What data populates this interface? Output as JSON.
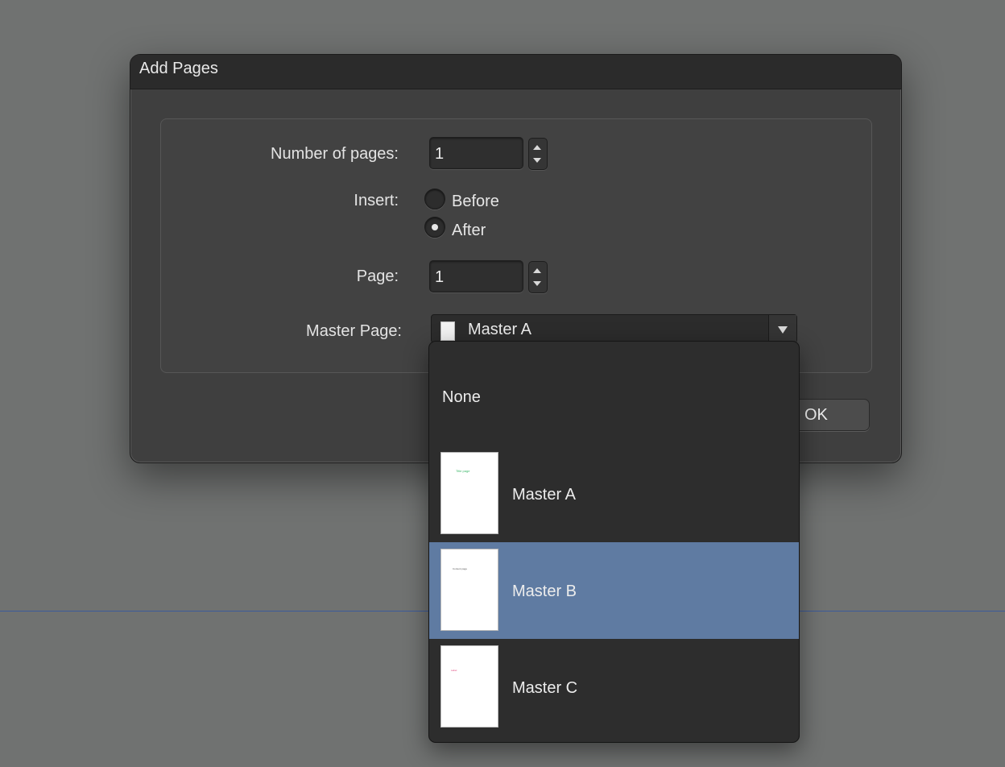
{
  "dialog": {
    "title": "Add Pages",
    "number_of_pages": {
      "label": "Number of pages:",
      "value": "1"
    },
    "insert": {
      "label": "Insert:",
      "options": [
        {
          "label": "Before",
          "checked": false
        },
        {
          "label": "After",
          "checked": true
        }
      ]
    },
    "page": {
      "label": "Page:",
      "value": "1"
    },
    "master_page": {
      "label": "Master Page:",
      "selected": "Master A"
    },
    "ok_label": "OK"
  },
  "dropdown": {
    "items": [
      {
        "label": "None",
        "thumbnail": null,
        "highlighted": false
      },
      {
        "label": "Master A",
        "thumbnail": {
          "text": "Title page",
          "color": "#3db86a"
        },
        "highlighted": false
      },
      {
        "label": "Master B",
        "thumbnail": {
          "text": "Content page",
          "color": "#555555"
        },
        "highlighted": true
      },
      {
        "label": "Master C",
        "thumbnail": {
          "text": "Label",
          "color": "#e0457b"
        },
        "highlighted": false
      }
    ]
  },
  "colors": {
    "background": "#707271",
    "dialog": "#3f3f3f",
    "highlight": "#5f7ba2",
    "guide_line": "#3c5a9a"
  }
}
